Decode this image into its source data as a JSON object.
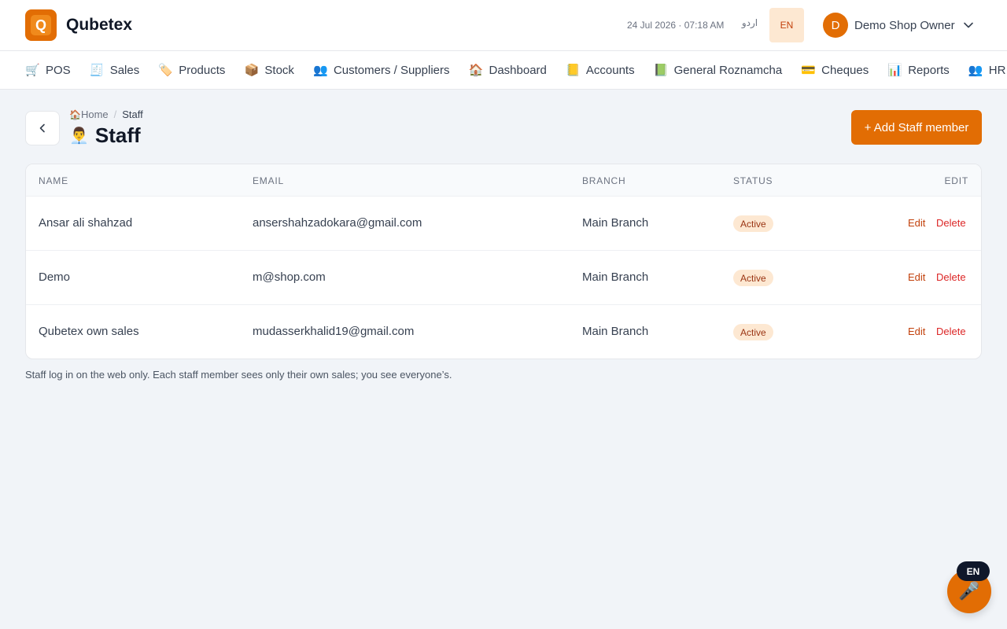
{
  "header": {
    "logo_letter": "Q",
    "brand": "Qubetex",
    "datetime": "24 Jul 2026 · 07:18 AM",
    "lang_urdu": "اردو",
    "lang_english": "EN",
    "user_initial": "D",
    "user_name": "Demo Shop Owner",
    "accent_color": "#e26d04"
  },
  "nav": {
    "items": [
      {
        "icon": "🛒",
        "icon_name": "cart-icon",
        "label": "POS"
      },
      {
        "icon": "🧾",
        "icon_name": "receipt-icon",
        "label": "Sales"
      },
      {
        "icon": "🏷️",
        "icon_name": "tag-icon",
        "label": "Products"
      },
      {
        "icon": "📦",
        "icon_name": "package-icon",
        "label": "Stock"
      },
      {
        "icon": "👥",
        "icon_name": "people-icon",
        "label": "Customers / Suppliers"
      },
      {
        "icon": "🏠",
        "icon_name": "house-icon",
        "label": "Dashboard"
      },
      {
        "icon": "📒",
        "icon_name": "ledger-icon",
        "label": "Accounts"
      },
      {
        "icon": "📗",
        "icon_name": "green-book-icon",
        "label": "General Roznamcha"
      },
      {
        "icon": "💳",
        "icon_name": "card-icon",
        "label": "Cheques"
      },
      {
        "icon": "📊",
        "icon_name": "bar-chart-icon",
        "label": "Reports"
      },
      {
        "icon": "👥",
        "icon_name": "people-icon",
        "label": "HR"
      }
    ]
  },
  "page": {
    "breadcrumb_home_icon": "🏠",
    "breadcrumb_home": "Home",
    "breadcrumb_separator": "/",
    "breadcrumb_current": "Staff",
    "title_icon": "👨‍💼",
    "title": "Staff",
    "add_button": "+ Add Staff member"
  },
  "table": {
    "headers": {
      "name": "NAME",
      "email": "EMAIL",
      "branch": "BRANCH",
      "status": "STATUS",
      "edit": "EDIT"
    },
    "rows": [
      {
        "name": "Ansar ali shahzad",
        "email": "ansershahzadokara@gmail.com",
        "branch": "Main Branch",
        "status": "Active",
        "edit": "Edit",
        "delete": "Delete"
      },
      {
        "name": "Demo",
        "email": "m@shop.com",
        "branch": "Main Branch",
        "status": "Active",
        "edit": "Edit",
        "delete": "Delete"
      },
      {
        "name": "Qubetex own sales",
        "email": "mudasserkhalid19@gmail.com",
        "branch": "Main Branch",
        "status": "Active",
        "edit": "Edit",
        "delete": "Delete"
      }
    ]
  },
  "footnote": "Staff log in on the web only. Each staff member sees only their own sales; you see everyone’s.",
  "voice": {
    "language_badge": "EN",
    "icon": "🎤",
    "icon_name": "microphone-icon"
  }
}
